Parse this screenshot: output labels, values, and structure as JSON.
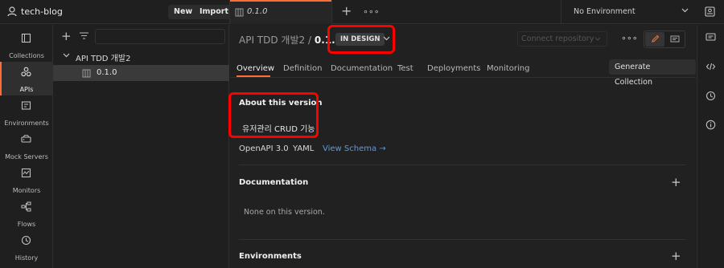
{
  "workspace": {
    "name": "tech-blog",
    "icon": "user-icon"
  },
  "top_buttons": {
    "new": "New",
    "import": "Import"
  },
  "tab": {
    "label": "0.1.0",
    "icon": "api-version-icon"
  },
  "environment": {
    "selected": "No Environment"
  },
  "left_nav": [
    {
      "label": "Collections",
      "icon": "collections-icon",
      "active": false
    },
    {
      "label": "APIs",
      "icon": "apis-icon",
      "active": true
    },
    {
      "label": "Environments",
      "icon": "environments-icon",
      "active": false
    },
    {
      "label": "Mock Servers",
      "icon": "mock-servers-icon",
      "active": false
    },
    {
      "label": "Monitors",
      "icon": "monitors-icon",
      "active": false
    },
    {
      "label": "Flows",
      "icon": "flows-icon",
      "active": false
    },
    {
      "label": "History",
      "icon": "history-icon",
      "active": false
    }
  ],
  "tree": {
    "api_name": "API TDD 개발2",
    "version": "0.1.0"
  },
  "header": {
    "api_name": "API TDD 개발2",
    "separator": "/",
    "version": "0.1.0",
    "status": "IN DESIGN",
    "connect_repo": "Connect repository"
  },
  "tabs": [
    "Overview",
    "Definition",
    "Documentation",
    "Test",
    "Deployments",
    "Monitoring"
  ],
  "generate_button": "Generate Collection",
  "about": {
    "title": "About this version",
    "description": "유저관리 CRUD 기능",
    "spec": "OpenAPI 3.0",
    "format": "YAML",
    "view_schema": "View Schema"
  },
  "documentation": {
    "title": "Documentation",
    "none": "None on this version."
  },
  "environments": {
    "title": "Environments"
  },
  "accent_color": "#ff6c37",
  "highlight_color": "#ff0000"
}
